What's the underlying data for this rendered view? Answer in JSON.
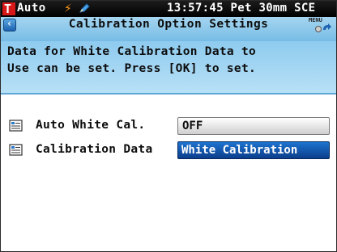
{
  "status": {
    "mode_letter": "T",
    "mode_label": "Auto",
    "info": "13:57:45 Pet 30mm SCE"
  },
  "header": {
    "title": "Calibration Option Settings",
    "menu_label": "MENU"
  },
  "message": {
    "line1": "Data for White Calibration Data to",
    "line2": "Use can be set. Press [OK] to set."
  },
  "settings": [
    {
      "label": "Auto White Cal.",
      "value": "OFF",
      "selected": false
    },
    {
      "label": "Calibration Data",
      "value": "White Calibration",
      "selected": true
    }
  ],
  "colors": {
    "mode_badge": "#d81818",
    "bolt": "#ff9a14",
    "selected_field": "#1d73cf",
    "titlebar": "#a5d5f0"
  }
}
